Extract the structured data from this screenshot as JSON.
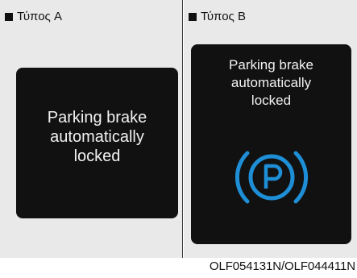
{
  "panel_a": {
    "heading": "Τύπος A",
    "message": [
      "Parking brake",
      "automatically",
      "locked"
    ]
  },
  "panel_b": {
    "heading": "Τύπος B",
    "message": [
      "Parking brake",
      "automatically",
      "locked"
    ],
    "icon": "parking-brake-icon",
    "icon_color": "#1e8fd6"
  },
  "caption": "OLF054131N/OLF044411N"
}
